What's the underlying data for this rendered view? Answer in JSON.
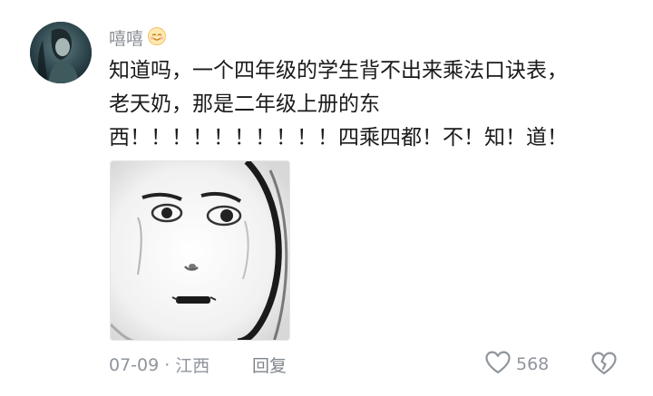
{
  "comment": {
    "username": "嘻嘻",
    "username_emoji": "smiling-face-emoji",
    "text_lines": [
      "知道吗，一个四年级的学生背不出来乘法口诀表，",
      "老天奶，那是二年级上册的东",
      "西！！！！！！！！！！四乘四都！不！知！道！"
    ],
    "sticker": "meme-face-sticker",
    "date": "07-09",
    "separator": "·",
    "location": "江西",
    "reply_label": "回复",
    "like_count": "568",
    "like_icon": "heart-outline-icon",
    "dislike_icon": "broken-heart-icon"
  }
}
